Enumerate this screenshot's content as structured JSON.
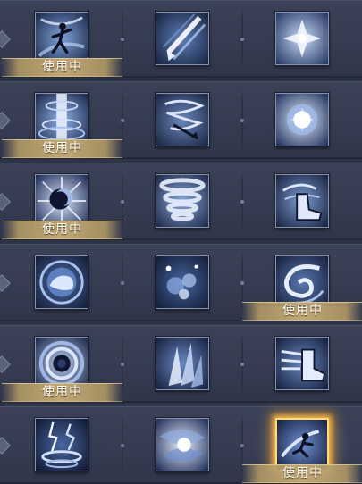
{
  "in_use_label": "使用中",
  "rows": [
    {
      "cells": [
        {
          "icon": "silhouette-figure-icon",
          "in_use": true,
          "selected": false
        },
        {
          "icon": "diagonal-slash-icon",
          "in_use": false,
          "selected": false
        },
        {
          "icon": "ice-crystal-flower-icon",
          "in_use": false,
          "selected": false
        }
      ]
    },
    {
      "cells": [
        {
          "icon": "light-pillar-icon",
          "in_use": true,
          "selected": false
        },
        {
          "icon": "tornado-spear-icon",
          "in_use": false,
          "selected": false
        },
        {
          "icon": "star-orb-icon",
          "in_use": false,
          "selected": false
        }
      ]
    },
    {
      "cells": [
        {
          "icon": "dark-moon-burst-icon",
          "in_use": true,
          "selected": false
        },
        {
          "icon": "whirlwind-icon",
          "in_use": false,
          "selected": false
        },
        {
          "icon": "wind-boot-icon",
          "in_use": false,
          "selected": false
        }
      ]
    },
    {
      "cells": [
        {
          "icon": "swirl-orb-creature-icon",
          "in_use": false,
          "selected": false
        },
        {
          "icon": "bubble-spark-icon",
          "in_use": false,
          "selected": false
        },
        {
          "icon": "storm-swirl-icon",
          "in_use": true,
          "selected": false
        }
      ]
    },
    {
      "cells": [
        {
          "icon": "vortex-icon",
          "in_use": true,
          "selected": false
        },
        {
          "icon": "ice-shard-icon",
          "in_use": false,
          "selected": false
        },
        {
          "icon": "dash-boot-icon",
          "in_use": false,
          "selected": false
        }
      ]
    },
    {
      "cells": [
        {
          "icon": "lightning-pillar-icon",
          "in_use": false,
          "selected": false
        },
        {
          "icon": "tunnel-vortex-icon",
          "in_use": false,
          "selected": false
        },
        {
          "icon": "wing-jump-figure-icon",
          "in_use": true,
          "selected": true
        }
      ]
    }
  ]
}
